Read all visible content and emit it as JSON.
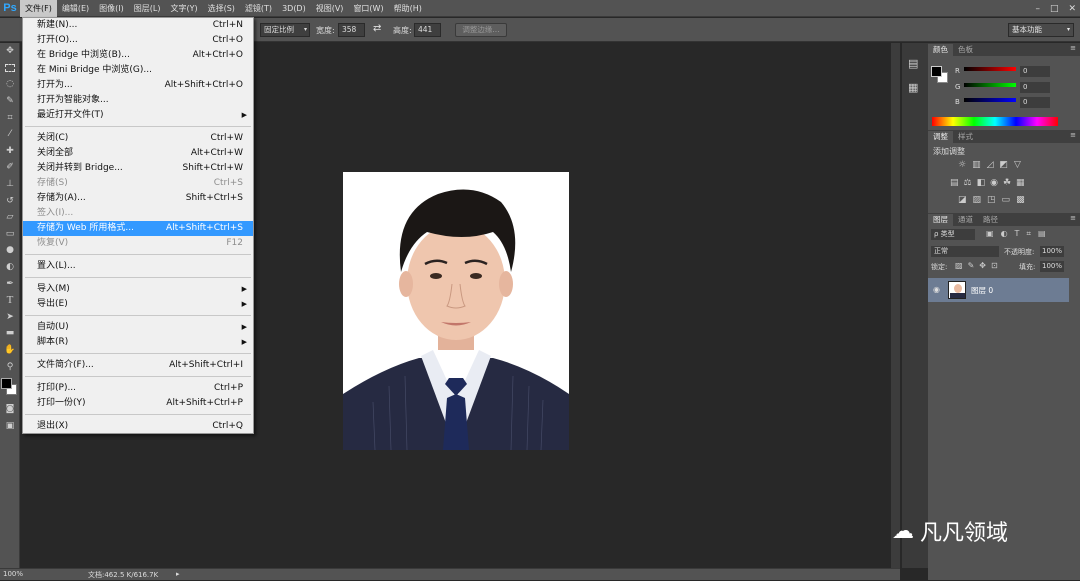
{
  "app": {
    "logo": "Ps"
  },
  "menubar": {
    "items": [
      "文件(F)",
      "编辑(E)",
      "图像(I)",
      "图层(L)",
      "文字(Y)",
      "选择(S)",
      "滤镜(T)",
      "3D(D)",
      "视图(V)",
      "窗口(W)",
      "帮助(H)"
    ]
  },
  "window_controls": {
    "minimize": "–",
    "maximize": "□",
    "close": "✕"
  },
  "options": {
    "style_value": "固定比例",
    "width_label": "宽度:",
    "width_value": "358",
    "swap_icon": "⇄",
    "height_label": "高度:",
    "height_value": "441",
    "refine_button": "调整边缘...",
    "workspace": "基本功能"
  },
  "file_menu": {
    "items": [
      {
        "label": "新建(N)...",
        "shortcut": "Ctrl+N"
      },
      {
        "label": "打开(O)...",
        "shortcut": "Ctrl+O"
      },
      {
        "label": "在 Bridge 中浏览(B)...",
        "shortcut": "Alt+Ctrl+O"
      },
      {
        "label": "在 Mini Bridge 中浏览(G)...",
        "shortcut": ""
      },
      {
        "label": "打开为...",
        "shortcut": "Alt+Shift+Ctrl+O"
      },
      {
        "label": "打开为智能对象...",
        "shortcut": ""
      },
      {
        "label": "最近打开文件(T)",
        "shortcut": ""
      },
      {
        "label": "关闭(C)",
        "shortcut": "Ctrl+W"
      },
      {
        "label": "关闭全部",
        "shortcut": "Alt+Ctrl+W"
      },
      {
        "label": "关闭并转到 Bridge...",
        "shortcut": "Shift+Ctrl+W"
      },
      {
        "label": "存储(S)",
        "shortcut": "Ctrl+S"
      },
      {
        "label": "存储为(A)...",
        "shortcut": "Shift+Ctrl+S"
      },
      {
        "label": "签入(I)...",
        "shortcut": ""
      },
      {
        "label": "存储为 Web 所用格式...",
        "shortcut": "Alt+Shift+Ctrl+S"
      },
      {
        "label": "恢复(V)",
        "shortcut": "F12"
      },
      {
        "label": "置入(L)...",
        "shortcut": ""
      },
      {
        "label": "导入(M)",
        "shortcut": ""
      },
      {
        "label": "导出(E)",
        "shortcut": ""
      },
      {
        "label": "自动(U)",
        "shortcut": ""
      },
      {
        "label": "脚本(R)",
        "shortcut": ""
      },
      {
        "label": "文件简介(F)...",
        "shortcut": "Alt+Shift+Ctrl+I"
      },
      {
        "label": "打印(P)...",
        "shortcut": "Ctrl+P"
      },
      {
        "label": "打印一份(Y)",
        "shortcut": "Alt+Shift+Ctrl+P"
      },
      {
        "label": "退出(X)",
        "shortcut": "Ctrl+Q"
      }
    ]
  },
  "color_panel": {
    "tabs": [
      "颜色",
      "色板"
    ],
    "r_label": "R",
    "g_label": "G",
    "b_label": "B",
    "r_value": "0",
    "g_value": "0",
    "b_value": "0"
  },
  "adjust_panel": {
    "tabs": [
      "调整",
      "样式"
    ],
    "title": "添加调整"
  },
  "layers_panel": {
    "tabs": [
      "图层",
      "通道",
      "路径"
    ],
    "filter_kind": "ρ 类型",
    "blend_mode": "正常",
    "opacity_label": "不透明度:",
    "opacity_value": "100%",
    "lock_label": "锁定:",
    "fill_label": "填充:",
    "fill_value": "100%",
    "layer_name": "图层 0"
  },
  "status": {
    "zoom": "100%",
    "doc_info": "文档:462.5 K/616.7K"
  },
  "watermark": {
    "text": "凡凡领域"
  },
  "colors": {
    "highlight": "#3399ff",
    "ps_blue": "#31a8ff",
    "suit": "#262a42",
    "tie": "#1e2a5a"
  }
}
